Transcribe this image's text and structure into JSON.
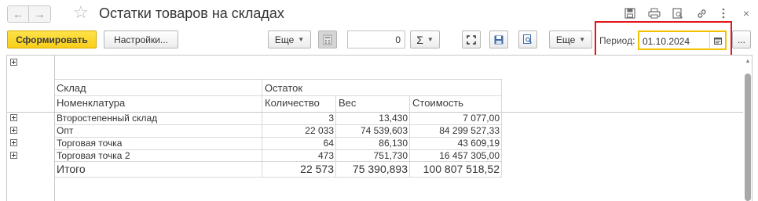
{
  "window": {
    "title": "Остатки товаров на складах",
    "icons": [
      "save-icon",
      "print-icon",
      "preview-icon",
      "link-icon",
      "more-vertical-icon",
      "close-icon"
    ]
  },
  "toolbar": {
    "generate_label": "Сформировать",
    "settings_label": "Настройки...",
    "more_label_1": "Еще",
    "amount_value": "0",
    "sum_label": "Σ",
    "more_label_2": "Еще",
    "period_label": "Период:",
    "period_value": "01.10.2024",
    "ellipsis_label": "..."
  },
  "report": {
    "header": {
      "group_warehouse": "Склад",
      "group_balance": "Остаток",
      "col_item": "Номенклатура",
      "col_qty": "Количество",
      "col_weight": "Вес",
      "col_cost": "Стоимость"
    },
    "rows": [
      {
        "name": "Второстепенный склад",
        "qty": "3",
        "weight": "13,430",
        "cost": "7 077,00"
      },
      {
        "name": "Опт",
        "qty": "22 033",
        "weight": "74 539,603",
        "cost": "84 299 527,33"
      },
      {
        "name": "Торговая точка",
        "qty": "64",
        "weight": "86,130",
        "cost": "43 609,19"
      },
      {
        "name": "Торговая точка 2",
        "qty": "473",
        "weight": "751,730",
        "cost": "16 457 305,00"
      }
    ],
    "total": {
      "label": "Итого",
      "qty": "22 573",
      "weight": "75 390,893",
      "cost": "100 807 518,52"
    }
  }
}
